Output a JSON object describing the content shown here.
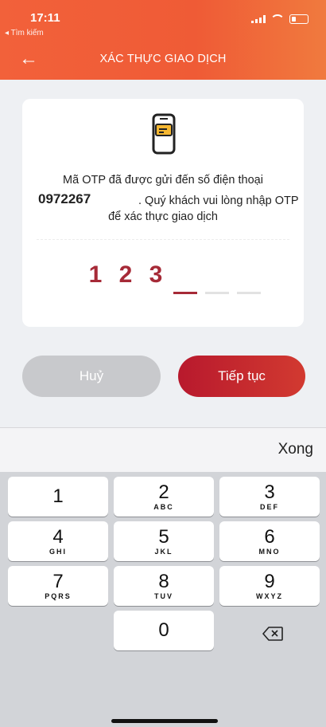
{
  "status_bar": {
    "time": "17:11",
    "back_app": "◂ Tìm kiếm"
  },
  "header": {
    "title": "XÁC THỰC GIAO DỊCH",
    "back_icon": "arrow-left-icon"
  },
  "card": {
    "icon": "phone-message-icon",
    "message_line1": "Mã OTP đã được gửi đến số điện thoại",
    "phone_number": "0972267",
    "message_line2": ". Quý khách vui lòng nhập OTP",
    "message_line3": "để xác thực giao dịch",
    "otp_digits": [
      "1",
      "2",
      "3"
    ],
    "otp_length": 6
  },
  "buttons": {
    "cancel": "Huỷ",
    "continue": "Tiếp tục"
  },
  "keyboard": {
    "done": "Xong",
    "keys": [
      {
        "num": "1",
        "letters": ""
      },
      {
        "num": "2",
        "letters": "ABC"
      },
      {
        "num": "3",
        "letters": "DEF"
      },
      {
        "num": "4",
        "letters": "GHI"
      },
      {
        "num": "5",
        "letters": "JKL"
      },
      {
        "num": "6",
        "letters": "MNO"
      },
      {
        "num": "7",
        "letters": "PQRS"
      },
      {
        "num": "8",
        "letters": "TUV"
      },
      {
        "num": "9",
        "letters": "WXYZ"
      },
      {
        "num": "0",
        "letters": ""
      }
    ]
  },
  "colors": {
    "header": "#ef5b36",
    "accent": "#a62a37",
    "cancel": "#c8c9cc"
  }
}
